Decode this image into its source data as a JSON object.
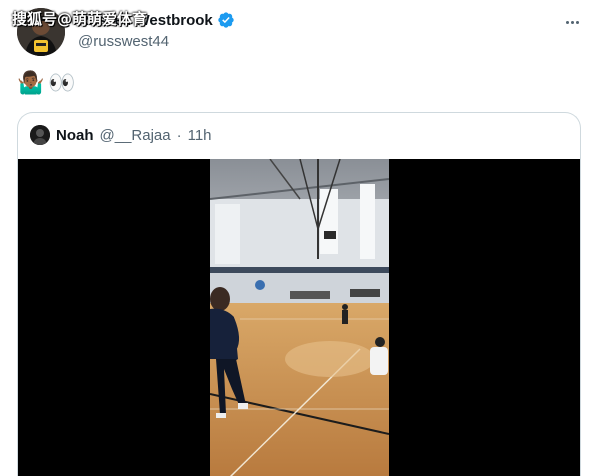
{
  "watermark": "搜狐号@萌萌爱体育",
  "tweet": {
    "display_name": "Russell Westbrook",
    "handle": "@russwest44",
    "emojis": [
      "🤷🏾‍♂️",
      "👀"
    ],
    "verified_icon": "verified-badge-icon",
    "more_icon": "more-options-icon"
  },
  "quote": {
    "display_name": "Noah",
    "handle": "@__Rajaa",
    "separator": "·",
    "time": "11h"
  },
  "colors": {
    "text_primary": "#0f1419",
    "text_secondary": "#536471",
    "verified_blue": "#1d9bf0",
    "border": "#cfd9de"
  }
}
